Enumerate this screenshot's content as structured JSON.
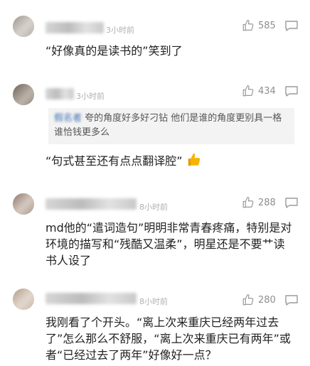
{
  "comments": [
    {
      "time": "3小时前",
      "likes": "585",
      "text": "“好像真的是读书的”笑到了"
    },
    {
      "time": "3小时前",
      "likes": "434",
      "quote_user": "假名者",
      "quote_text": "夸的角度好多好刁钻 他们是谁的角度更别具一格谁恰钱更多么",
      "text": "“句式甚至还有点点翻译腔”",
      "emoji": "thumbs-up-emoji"
    },
    {
      "time": "8小时前",
      "likes": "288",
      "text": "md他的“遣词造句”明明非常青春疼痛，特别是对环境的描写和“残酷又温柔”，明星还是不要艹读书人设了"
    },
    {
      "time": "8小时前",
      "likes": "280",
      "text": "我刚看了个开头。“离上次来重庆已经两年过去了”怎么那么不舒服，“离上次来重庆已有两年”或者“已经过去了两年”好像好一点？"
    }
  ],
  "icons": {
    "like": "thumbs-up-outline-icon",
    "reply": "comment-bubble-icon",
    "emoji_color": "#f5b400"
  }
}
